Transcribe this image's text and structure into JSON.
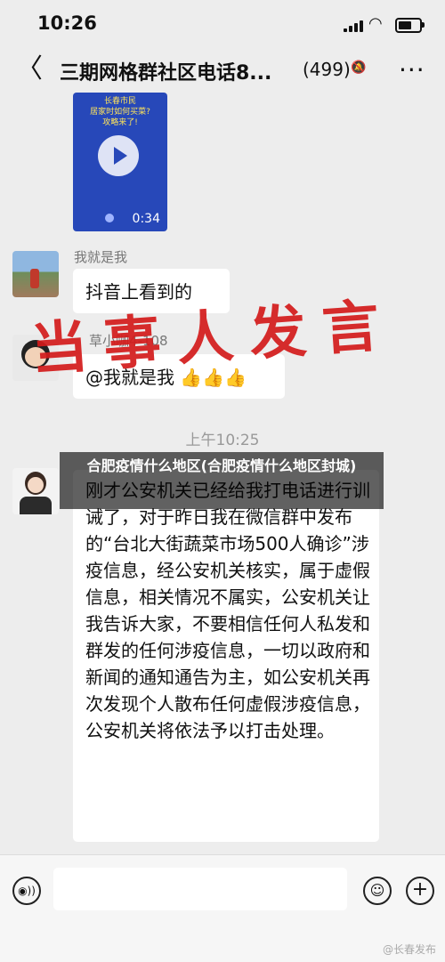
{
  "status_bar": {
    "time": "10:26"
  },
  "nav": {
    "back_glyph": "〈",
    "title": "三期网格群社区电话8...",
    "member_count": "(499)",
    "mute_glyph": "🔕",
    "more_glyph": "···"
  },
  "messages": {
    "video": {
      "caption": "长春市民\n居家时如何买菜?\n攻略来了!",
      "duration": "0:34"
    },
    "msg1": {
      "sender": "我就是我",
      "text": "抖音上看到的"
    },
    "msg2": {
      "sender": "草小咖4-108",
      "text": "@我就是我 👍👍👍"
    },
    "timestamp": "上午10:25",
    "msg3": {
      "text": "刚才公安机关已经给我打电话进行训诫了，对于昨日我在微信群中发布的“台北大街蔬菜市场500人确诊”涉疫信息，经公安机关核实，属于虚假信息，相关情况不属实，公安机关让我告诉大家，不要相信任何人私发和群发的任何涉疫信息，一切以政府和新闻的通知通告为主，如公安机关再次发现个人散布任何虚假涉疫信息，公安机关将依法予以打击处理。"
    }
  },
  "overlay": {
    "watermark": "当事人发言",
    "article_title": "合肥疫情什么地区(合肥疫情什么地区封城)"
  },
  "input_bar": {
    "voice_glyph": "◉))",
    "emoji_glyph": "☺",
    "plus_glyph": "+"
  },
  "credit": "@长春发布"
}
